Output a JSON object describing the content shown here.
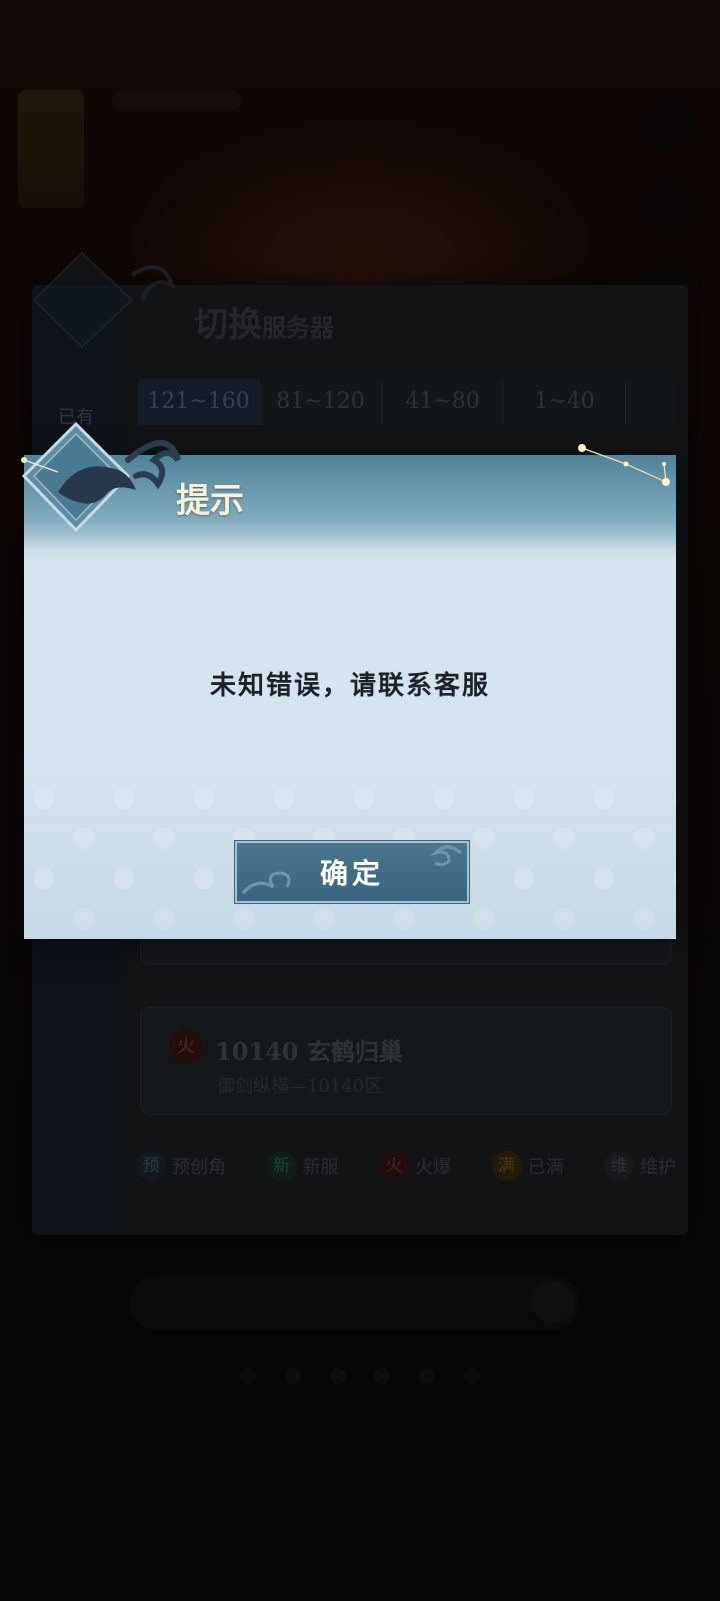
{
  "server_panel": {
    "title_big": "切换",
    "title_small": "服务器",
    "sidebar_label": "已有",
    "tabs": [
      "121~160",
      "81~120",
      "41~80",
      "1~40"
    ],
    "server": {
      "badge": "火",
      "name": "10140 玄鹤归巢",
      "sub": "御剑纵横—10140区"
    },
    "legend": [
      {
        "badge": "预",
        "label": "预创角"
      },
      {
        "badge": "新",
        "label": "新服"
      },
      {
        "badge": "火",
        "label": "火爆"
      },
      {
        "badge": "满",
        "label": "已满"
      },
      {
        "badge": "维",
        "label": "维护"
      }
    ]
  },
  "dialog": {
    "title": "提示",
    "message": "未知错误，请联系客服",
    "confirm_label": "确定"
  },
  "colors": {
    "dialog_header": "#5f91a6",
    "dialog_body": "#d6e6f0",
    "button": "#3f6c86",
    "title_text": "#fbf1d6"
  }
}
